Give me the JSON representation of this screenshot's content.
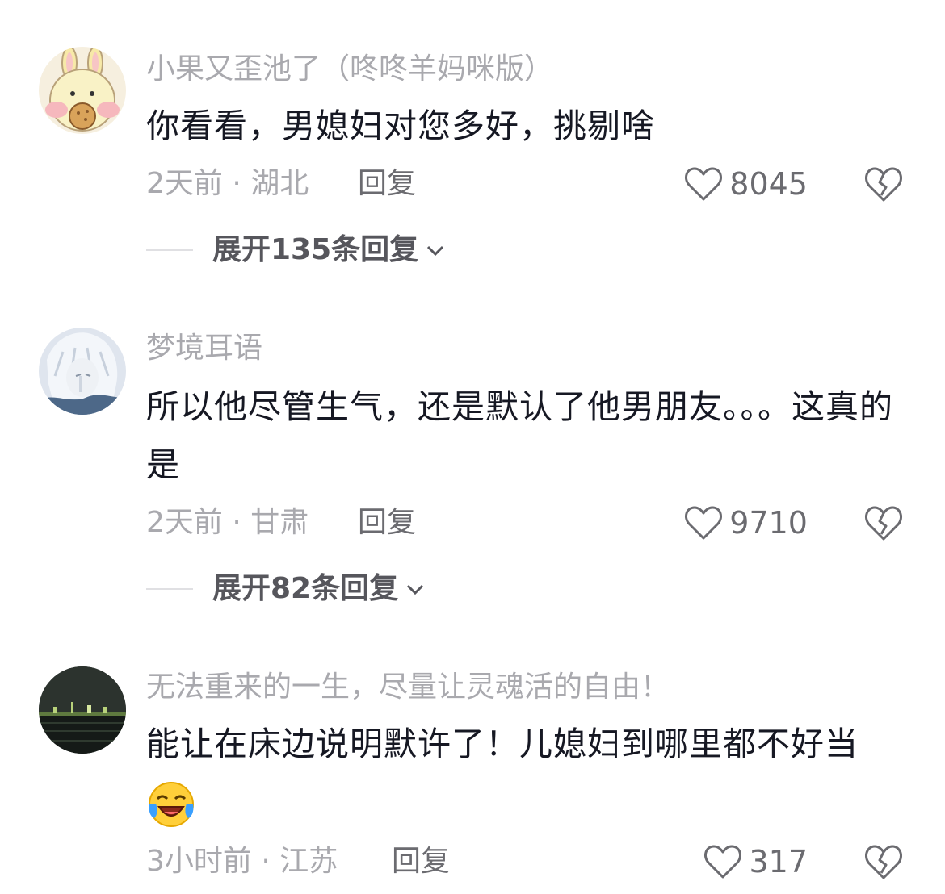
{
  "comments": [
    {
      "username": "小果又歪池了（咚咚羊妈咪版）",
      "text": "你看看，男媳妇对您多好，挑剔啥",
      "time_location": "2天前 · 湖北",
      "reply_label": "回复",
      "likes": "8045",
      "expand_label": "展开135条回复",
      "avatar_icon": "cartoon-bunny-avatar"
    },
    {
      "username": "梦境耳语",
      "text": "所以他尽管生气，还是默认了他男朋友。。。这真的是",
      "time_location": "2天前 · 甘肃",
      "reply_label": "回复",
      "likes": "9710",
      "expand_label": "展开82条回复",
      "avatar_icon": "anime-character-avatar"
    },
    {
      "username": "无法重来的一生，尽量让灵魂活的自由！",
      "text": "能让在床边说明默许了！儿媳妇到哪里都不好当",
      "emoji": "laughing-crying-emoji",
      "time_location": "3小时前 · 江苏",
      "reply_label": "回复",
      "likes": "317",
      "avatar_icon": "night-cityscape-avatar"
    }
  ],
  "colors": {
    "text_primary": "#161823",
    "text_secondary": "#a9a9ae",
    "background": "#ffffff"
  }
}
